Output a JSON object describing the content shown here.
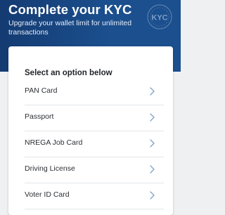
{
  "header": {
    "title": "Complete your KYC",
    "subtitle": "Upgrade your wallet limit for unlimited transactions",
    "logo_text": "KYC"
  },
  "card": {
    "heading": "Select an option below",
    "options": [
      {
        "label": "PAN Card",
        "icon": "chevron-right-icon"
      },
      {
        "label": "Passport",
        "icon": "chevron-right-icon"
      },
      {
        "label": "NREGA Job Card",
        "icon": "chevron-right-icon"
      },
      {
        "label": "Driving License",
        "icon": "chevron-right-icon"
      },
      {
        "label": "Voter ID Card",
        "icon": "chevron-right-icon"
      }
    ]
  },
  "colors": {
    "header_bg": "#1b4f8e",
    "page_bg": "#eef0f2",
    "chevron": "#7fa6c9"
  }
}
